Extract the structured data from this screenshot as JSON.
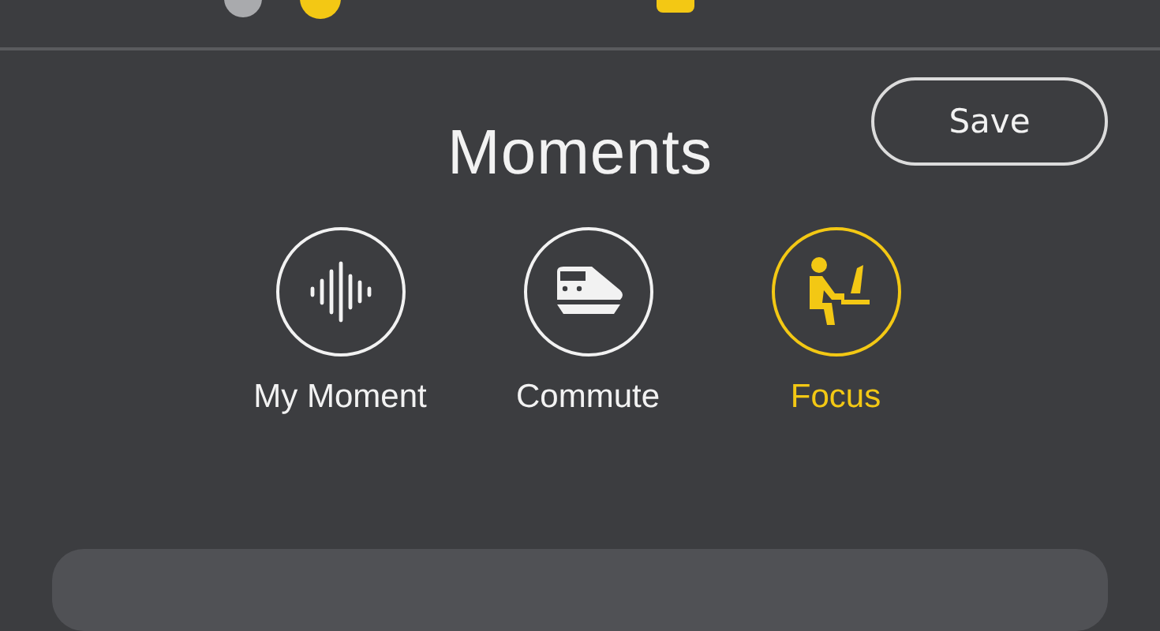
{
  "header": {
    "title": "Moments",
    "save_button": "Save"
  },
  "moments": [
    {
      "kind": "waveform",
      "label": "My Moment",
      "selected": false
    },
    {
      "kind": "train",
      "label": "Commute",
      "selected": false
    },
    {
      "kind": "desk",
      "label": "Focus",
      "selected": true
    }
  ]
}
